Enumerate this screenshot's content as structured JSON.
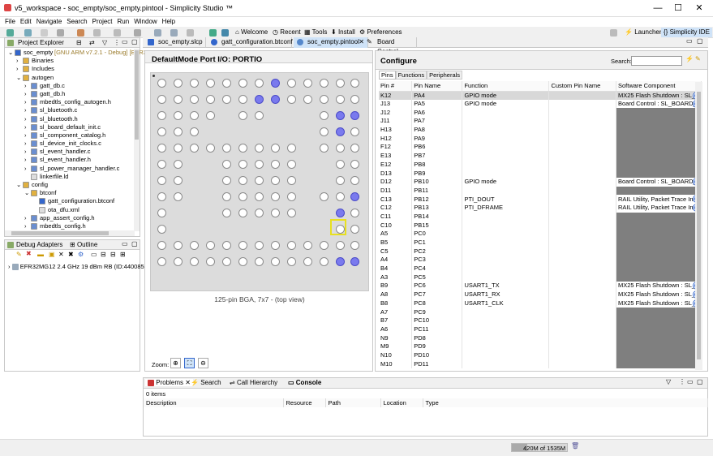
{
  "window": {
    "title": "v5_workspace - soc_empty/soc_empty.pintool - Simplicity Studio ™"
  },
  "menu": [
    "File",
    "Edit",
    "Navigate",
    "Search",
    "Project",
    "Run",
    "Window",
    "Help"
  ],
  "toolbar": {
    "welcome": "Welcome",
    "recent": "Recent",
    "tools": "Tools",
    "install": "Install",
    "preferences": "Preferences",
    "launcher": "Launcher",
    "simplicity_ide": "Simplicity IDE"
  },
  "project_explorer": {
    "title": "Project Explorer",
    "tree": [
      {
        "label": "soc_empty",
        "suffix": " [GNU ARM v7.2.1 - Debug] [EFR3",
        "level": 0,
        "icon": "project"
      },
      {
        "label": "Binaries",
        "level": 1,
        "icon": "folder"
      },
      {
        "label": "Includes",
        "level": 1,
        "icon": "folder"
      },
      {
        "label": "autogen",
        "level": 1,
        "icon": "folder"
      },
      {
        "label": "gatt_db.c",
        "level": 2,
        "icon": "file"
      },
      {
        "label": "gatt_db.h",
        "level": 2,
        "icon": "file"
      },
      {
        "label": "mbedtls_config_autogen.h",
        "level": 2,
        "icon": "file"
      },
      {
        "label": "sl_bluetooth.c",
        "level": 2,
        "icon": "file"
      },
      {
        "label": "sl_bluetooth.h",
        "level": 2,
        "icon": "file"
      },
      {
        "label": "sl_board_default_init.c",
        "level": 2,
        "icon": "file"
      },
      {
        "label": "sl_component_catalog.h",
        "level": 2,
        "icon": "file"
      },
      {
        "label": "sl_device_init_clocks.c",
        "level": 2,
        "icon": "file"
      },
      {
        "label": "sl_event_handler.c",
        "level": 2,
        "icon": "file"
      },
      {
        "label": "sl_event_handler.h",
        "level": 2,
        "icon": "file"
      },
      {
        "label": "sl_power_manager_handler.c",
        "level": 2,
        "icon": "file"
      },
      {
        "label": "linkerfile.ld",
        "level": 2,
        "icon": "plain"
      },
      {
        "label": "config",
        "level": 1,
        "icon": "folder"
      },
      {
        "label": "btconf",
        "level": 2,
        "icon": "folder"
      },
      {
        "label": "gatt_configuration.btconf",
        "level": 3,
        "icon": "bt"
      },
      {
        "label": "ota_dfu.xml",
        "level": 3,
        "icon": "plain"
      },
      {
        "label": "app_assert_config.h",
        "level": 2,
        "icon": "file"
      },
      {
        "label": "mbedtls_config.h",
        "level": 2,
        "icon": "file"
      }
    ]
  },
  "debug_adapters": {
    "title": "Debug Adapters",
    "outline": "Outline",
    "item": "EFR32MG12 2.4 GHz 19 dBm RB (ID:440085388)"
  },
  "editor_tabs": [
    "soc_empty.slcp",
    "gatt_configuration.btconf",
    "soc_empty.pintool",
    "Board Control"
  ],
  "portio": {
    "title": "DefaultMode Port I/O: PORTIO",
    "caption": "125-pin BGA, 7x7 - (top view)",
    "zoom_label": "Zoom:"
  },
  "configure": {
    "title": "Configure",
    "search_label": "Search:",
    "search_value": "",
    "tabs": [
      "Pins",
      "Functions",
      "Peripherals"
    ],
    "columns": [
      "Pin #",
      "Pin Name",
      "Function",
      "Custom Pin Name",
      "Software Component"
    ],
    "rows": [
      [
        "K12",
        "PA4",
        "GPIO mode",
        "",
        "MX25 Flash Shutdown : SL_M",
        1
      ],
      [
        "J13",
        "PA5",
        "GPIO mode",
        "",
        "Board Control : SL_BOARD_E",
        1
      ],
      [
        "J12",
        "PA6",
        "",
        "",
        "",
        0
      ],
      [
        "J11",
        "PA7",
        "",
        "",
        "",
        0
      ],
      [
        "H13",
        "PA8",
        "",
        "",
        "",
        0
      ],
      [
        "H12",
        "PA9",
        "",
        "",
        "",
        0
      ],
      [
        "F12",
        "PB6",
        "",
        "",
        "",
        0
      ],
      [
        "E13",
        "PB7",
        "",
        "",
        "",
        0
      ],
      [
        "E12",
        "PB8",
        "",
        "",
        "",
        0
      ],
      [
        "D13",
        "PB9",
        "",
        "",
        "",
        0
      ],
      [
        "D12",
        "PB10",
        "GPIO mode",
        "",
        "Board Control : SL_BOARD_E",
        1
      ],
      [
        "D11",
        "PB11",
        "",
        "",
        "",
        0
      ],
      [
        "C13",
        "PB12",
        "PTI_DOUT",
        "",
        "RAIL Utility, Packet Trace Info",
        1
      ],
      [
        "C12",
        "PB13",
        "PTI_DFRAME",
        "",
        "RAIL Utility, Packet Trace Info",
        1
      ],
      [
        "C11",
        "PB14",
        "",
        "",
        "",
        0
      ],
      [
        "C10",
        "PB15",
        "",
        "",
        "",
        0
      ],
      [
        "A5",
        "PC0",
        "",
        "",
        "",
        0
      ],
      [
        "B5",
        "PC1",
        "",
        "",
        "",
        0
      ],
      [
        "C5",
        "PC2",
        "",
        "",
        "",
        0
      ],
      [
        "A4",
        "PC3",
        "",
        "",
        "",
        0
      ],
      [
        "B4",
        "PC4",
        "",
        "",
        "",
        0
      ],
      [
        "A3",
        "PC5",
        "",
        "",
        "",
        0
      ],
      [
        "B9",
        "PC6",
        "USART1_TX",
        "",
        "MX25 Flash Shutdown : SL_M",
        1
      ],
      [
        "A8",
        "PC7",
        "USART1_RX",
        "",
        "MX25 Flash Shutdown : SL_M",
        1
      ],
      [
        "B8",
        "PC8",
        "USART1_CLK",
        "",
        "MX25 Flash Shutdown : SL_M",
        1
      ],
      [
        "A7",
        "PC9",
        "",
        "",
        "",
        0
      ],
      [
        "B7",
        "PC10",
        "",
        "",
        "",
        0
      ],
      [
        "A6",
        "PC11",
        "",
        "",
        "",
        0
      ],
      [
        "N9",
        "PD8",
        "",
        "",
        "",
        0
      ],
      [
        "M9",
        "PD9",
        "",
        "",
        "",
        0
      ],
      [
        "N10",
        "PD10",
        "",
        "",
        "",
        0
      ],
      [
        "M10",
        "PD11",
        "",
        "",
        "",
        0
      ]
    ]
  },
  "bottom": {
    "tabs": [
      "Problems",
      "Search",
      "Call Hierarchy",
      "Console"
    ],
    "items": "0 items",
    "columns": [
      "Description",
      "Resource",
      "Path",
      "Location",
      "Type"
    ]
  },
  "status": {
    "memory": "420M of 1535M"
  },
  "colors": {
    "pin_selected": "#7a7aee",
    "active_tab": "#cfe3f8",
    "grey_cell": "#7f7f7f"
  }
}
